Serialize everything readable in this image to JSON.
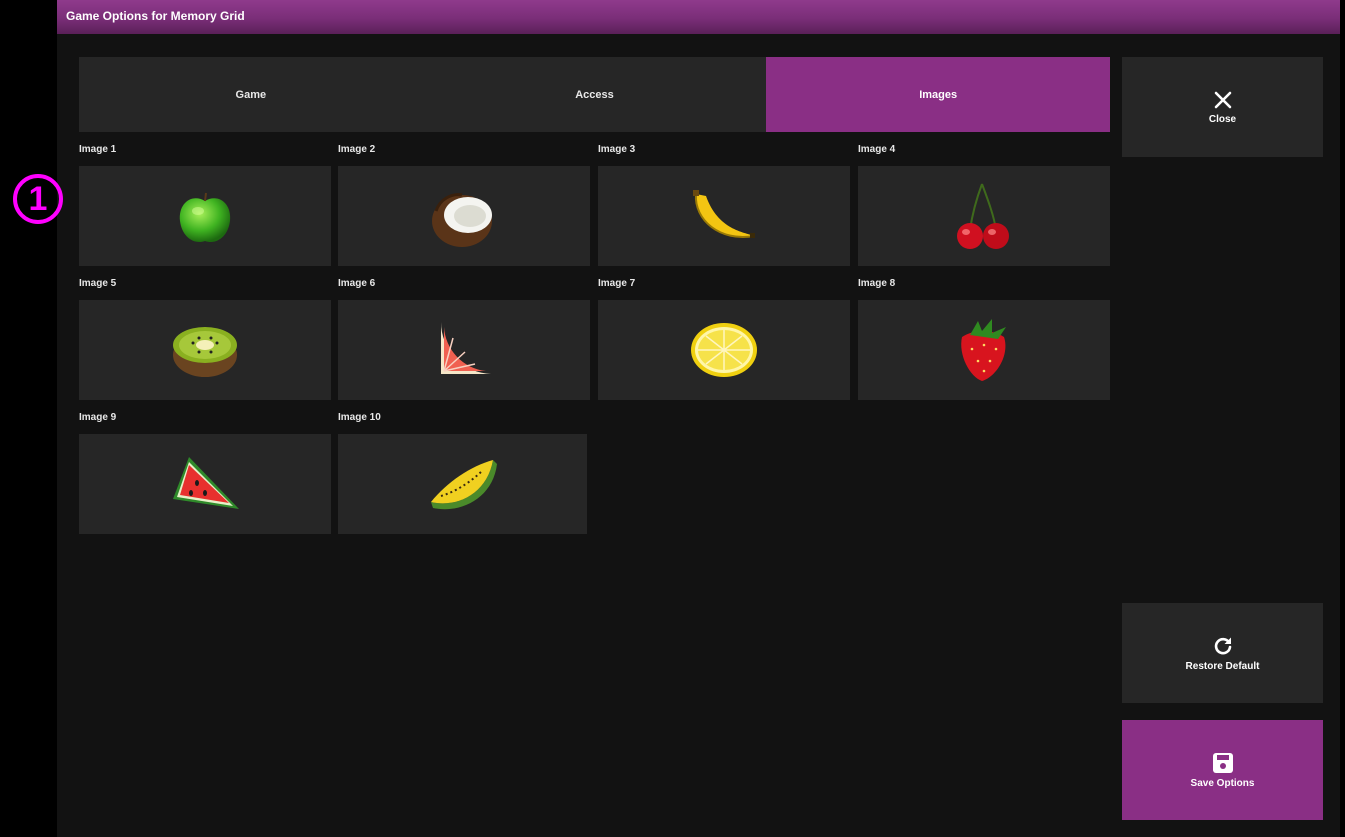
{
  "window": {
    "title": "Game Options for Memory Grid"
  },
  "tabs": [
    {
      "label": "Game",
      "active": false
    },
    {
      "label": "Access",
      "active": false
    },
    {
      "label": "Images",
      "active": true
    }
  ],
  "buttons": {
    "close_label": "Close",
    "restore_label": "Restore Default",
    "save_label": "Save Options"
  },
  "images": [
    {
      "label": "Image 1",
      "icon": "green-apple-icon"
    },
    {
      "label": "Image 2",
      "icon": "coconut-icon"
    },
    {
      "label": "Image 3",
      "icon": "banana-icon"
    },
    {
      "label": "Image 4",
      "icon": "cherries-icon"
    },
    {
      "label": "Image 5",
      "icon": "kiwi-icon"
    },
    {
      "label": "Image 6",
      "icon": "grapefruit-slice-icon"
    },
    {
      "label": "Image 7",
      "icon": "lemon-half-icon"
    },
    {
      "label": "Image 8",
      "icon": "strawberry-icon"
    },
    {
      "label": "Image 9",
      "icon": "watermelon-slice-icon"
    },
    {
      "label": "Image 10",
      "icon": "melon-slice-icon"
    }
  ],
  "annotation": {
    "marker": "1",
    "color": "#ff00ff"
  },
  "colors": {
    "accent": "#8a2f85",
    "panel": "#262626",
    "background": "#121212"
  }
}
